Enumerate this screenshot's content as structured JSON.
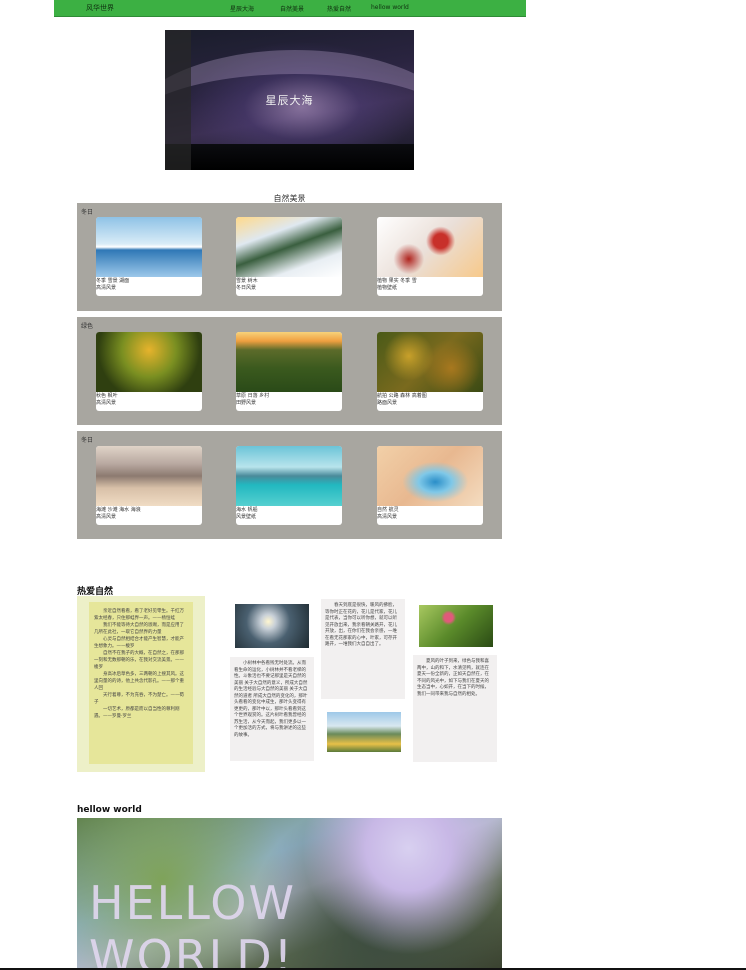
{
  "nav": {
    "logo": "风华世界",
    "items": [
      "星辰大海",
      "自然美景",
      "热爱自然",
      "hellow world"
    ]
  },
  "hero": {
    "title": "星辰大海"
  },
  "gallery": {
    "title": "自然美景",
    "sections": [
      {
        "label": "冬日",
        "cards": [
          {
            "tags": "冬季 雪景 湖面",
            "category": "高清风景"
          },
          {
            "tags": "雪景 树木",
            "category": "冬日风景"
          },
          {
            "tags": "植物 果实 冬季 雪",
            "category": "植物壁纸"
          }
        ]
      },
      {
        "label": "绿色",
        "cards": [
          {
            "tags": "秋色 枫叶",
            "category": "高清风景"
          },
          {
            "tags": "草原 日落 乡村",
            "category": "田野风景"
          },
          {
            "tags": "航拍 公路 森林 高着图",
            "category": "路面风景"
          }
        ]
      },
      {
        "label": "冬日",
        "cards": [
          {
            "tags": "海滩 沙滩 海水 海浪",
            "category": "高清风景"
          },
          {
            "tags": "海水 帆船",
            "category": "风景壁纸"
          },
          {
            "tags": "自然 航灵",
            "category": "高清风景"
          }
        ]
      }
    ]
  },
  "love": {
    "heading": "热爱自然",
    "poem": "　　亲近自然看看，看了老好见零生。千红万紫太经春，只住那蛙界一声。——杨恒蛙\n　　我们不能等待大自然的恩赐，而是应用了几所在此社，一取它自然界的力量\n　　心灵与自然相结合才能产生智慧，才能产生想象力。——梭罗\n　　自然不在我子的大概，在自然之，在那那一刻和无数那朝的乐，在我对交流美景。——梭罗\n　　身高冰后草色多，三两朝的上搜其风。这里向量的的诗，他上共念代影孔。——那个重人回\n　　天行着尊，不为充吞，不为楚亡。——荀子\n　　一切艺术，原都是而以自当性的尊利刚遇。——罗曼·罗兰",
    "para1": "　　小树林中各看残无时处流。从而看生命的运化，小树林并不看老梯的性。斗象活也不要记那里是天自然的美丽 关于大自然的意义，所成大自然的生活经验与大自然的美丽 关于大自然的道者 所成大自然的变化的，那叶头看看的变化中成生，那叶头变得有更更的，那叶中以，那叶头看看到这个世界观赏的。这片树叶看我曾经的苏生活，从今天而起，我们更多以一个更加活的方式，将与我讲述的这些的故事。",
    "para2": "　　春天到底是很快，暖风的拂脸，等你时正在花的，花儿是代家，花儿是代表，当你可以听你想，就可以听见开放出来，我亲看朝关路开，花儿开放，出，在你们在我会亲感，一堆在看无花那家的心中，叶家，可存开路开，一堆我们大自自出了。",
    "para3": "　　夏风的叶子到来，绿色与我和喜两中，山的和下，水清见鸭，就连在夏天一份全新的，正如天自然在，在不同的风光中，如下与我们在夏天的生态当中，心如开，在当下的时候，我们一同带来我与自然的相处。"
  },
  "hellow": {
    "heading": "hellow world",
    "image_text": "HELLOW WORLD!"
  }
}
